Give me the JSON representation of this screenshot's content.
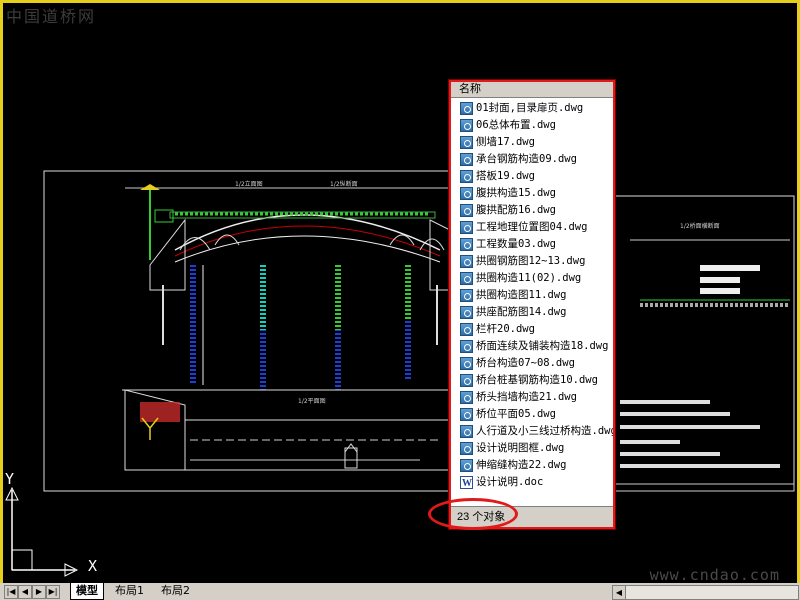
{
  "watermark_top": "中国道桥网",
  "watermark_bottom": "www.cndao.com",
  "ucs": {
    "y_label": "Y",
    "x_label": "X"
  },
  "explorer": {
    "column_header": "名称",
    "files": [
      {
        "name": "01封面,目录扉页.dwg",
        "type": "dwg"
      },
      {
        "name": "06总体布置.dwg",
        "type": "dwg"
      },
      {
        "name": "侧墙17.dwg",
        "type": "dwg"
      },
      {
        "name": "承台钢筋构造09.dwg",
        "type": "dwg"
      },
      {
        "name": "搭板19.dwg",
        "type": "dwg"
      },
      {
        "name": "腹拱构造15.dwg",
        "type": "dwg"
      },
      {
        "name": "腹拱配筋16.dwg",
        "type": "dwg"
      },
      {
        "name": "工程地理位置图04.dwg",
        "type": "dwg"
      },
      {
        "name": "工程数量03.dwg",
        "type": "dwg"
      },
      {
        "name": "拱圈钢筋图12~13.dwg",
        "type": "dwg"
      },
      {
        "name": "拱圈构造11(02).dwg",
        "type": "dwg"
      },
      {
        "name": "拱圈构造图11.dwg",
        "type": "dwg"
      },
      {
        "name": "拱座配筋图14.dwg",
        "type": "dwg"
      },
      {
        "name": "栏杆20.dwg",
        "type": "dwg"
      },
      {
        "name": "桥面连续及铺装构造18.dwg",
        "type": "dwg"
      },
      {
        "name": "桥台构造07~08.dwg",
        "type": "dwg"
      },
      {
        "name": "桥台桩基钢筋构造10.dwg",
        "type": "dwg"
      },
      {
        "name": "桥头挡墙构造21.dwg",
        "type": "dwg"
      },
      {
        "name": "桥位平面05.dwg",
        "type": "dwg"
      },
      {
        "name": "人行道及小三线过桥构造.dwg",
        "type": "dwg"
      },
      {
        "name": "设计说明图框.dwg",
        "type": "dwg"
      },
      {
        "name": "伸缩缝构造22.dwg",
        "type": "dwg"
      },
      {
        "name": "设计说明.doc",
        "type": "doc"
      }
    ],
    "status": "23 个对象"
  },
  "tabs": {
    "model": "模型",
    "layout1": "布局1",
    "layout2": "布局2"
  },
  "nav_arrows": [
    "|◀",
    "◀",
    "▶",
    "▶|"
  ],
  "colors": {
    "frame": "#e6cf1a",
    "highlight": "#e0191b",
    "background": "#000000"
  }
}
